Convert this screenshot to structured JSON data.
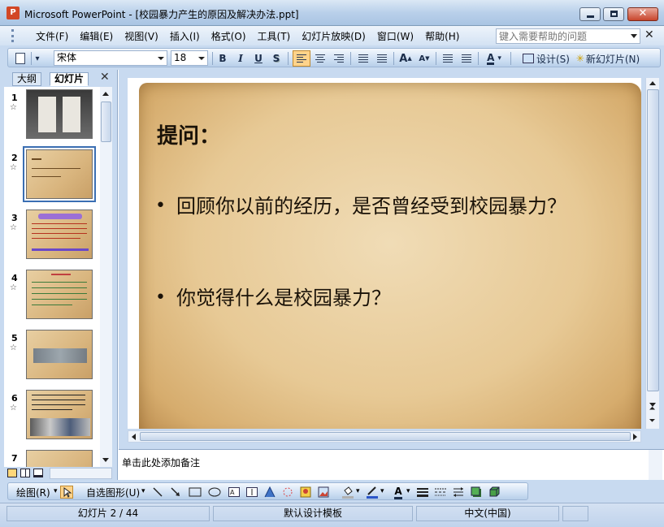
{
  "window": {
    "title": "Microsoft PowerPoint - [校园暴力产生的原因及解决办法.ppt]",
    "app_icon_letter": "P"
  },
  "menu": {
    "items": [
      "文件(F)",
      "编辑(E)",
      "视图(V)",
      "插入(I)",
      "格式(O)",
      "工具(T)",
      "幻灯片放映(D)",
      "窗口(W)",
      "帮助(H)"
    ],
    "help_placeholder": "键入需要帮助的问题"
  },
  "toolbar": {
    "font_name": "宋体",
    "font_size": "18",
    "bold": "B",
    "italic": "I",
    "underline": "U",
    "shadow": "S",
    "design_label": "设计(S)",
    "new_slide_label": "新幻灯片(N)"
  },
  "left_pane": {
    "tab_outline": "大纲",
    "tab_slides": "幻灯片",
    "selected_slide": 2,
    "slides": [
      {
        "number": "1"
      },
      {
        "number": "2"
      },
      {
        "number": "3"
      },
      {
        "number": "4"
      },
      {
        "number": "5"
      },
      {
        "number": "6"
      },
      {
        "number": "7"
      }
    ]
  },
  "slide": {
    "title": "提问：",
    "bullets": [
      "回顾你以前的经历，是否曾经受到校园暴力？",
      "你觉得什么是校园暴力？"
    ]
  },
  "notes": {
    "placeholder": "单击此处添加备注"
  },
  "drawing_toolbar": {
    "draw_label": "绘图(R)",
    "autoshapes_label": "自选图形(U)"
  },
  "status": {
    "slide_position": "幻灯片 2 / 44",
    "design_template": "默认设计模板",
    "language": "中文(中国)"
  },
  "colors": {
    "chrome": "#c8daf0",
    "slide_parchment": "#e7c995",
    "text": "#1a1208",
    "selection": "#3b6fb3"
  }
}
